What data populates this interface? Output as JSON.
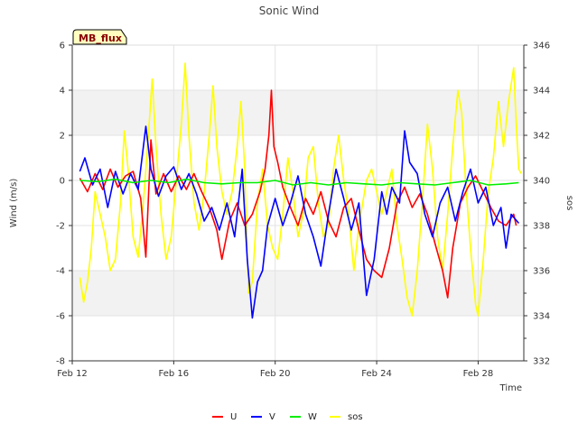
{
  "chart_data": {
    "type": "line",
    "title": "Sonic Wind",
    "badge": "MB_flux",
    "xlabel": "Time",
    "ylabel_left": "Wind (m/s)",
    "ylabel_right": "sos",
    "x_ticks": [
      "Feb 12",
      "Feb 16",
      "Feb 20",
      "Feb 24",
      "Feb 28"
    ],
    "x_tick_days": [
      12,
      16,
      20,
      24,
      28
    ],
    "xlim_days": [
      12,
      29.8
    ],
    "ylim_left": [
      -8,
      6
    ],
    "ylim_right": [
      332,
      346
    ],
    "y_ticks_left": [
      "-8",
      "-6",
      "-4",
      "-2",
      "0",
      "2",
      "4",
      "6"
    ],
    "y_ticks_right": [
      "332",
      "334",
      "336",
      "338",
      "340",
      "342",
      "344",
      "346"
    ],
    "shaded_bands_left": [
      [
        -6,
        -4
      ],
      [
        2,
        4
      ]
    ],
    "grid": true,
    "legend_position": "bottom",
    "series": [
      {
        "name": "U",
        "axis": "left",
        "color": "#ff0000",
        "points": [
          [
            12.3,
            0.1
          ],
          [
            12.6,
            -0.5
          ],
          [
            12.9,
            0.3
          ],
          [
            13.2,
            -0.4
          ],
          [
            13.5,
            0.5
          ],
          [
            13.8,
            -0.3
          ],
          [
            14.1,
            0.2
          ],
          [
            14.4,
            0.4
          ],
          [
            14.7,
            -0.8
          ],
          [
            14.9,
            -3.4
          ],
          [
            15.1,
            1.8
          ],
          [
            15.3,
            -0.6
          ],
          [
            15.6,
            0.3
          ],
          [
            15.9,
            -0.5
          ],
          [
            16.2,
            0.2
          ],
          [
            16.5,
            -0.4
          ],
          [
            16.8,
            0.3
          ],
          [
            17.1,
            -0.5
          ],
          [
            17.4,
            -1.2
          ],
          [
            17.7,
            -2.2
          ],
          [
            17.9,
            -3.5
          ],
          [
            18.2,
            -1.8
          ],
          [
            18.5,
            -1.0
          ],
          [
            18.8,
            -2.0
          ],
          [
            19.1,
            -1.5
          ],
          [
            19.4,
            -0.5
          ],
          [
            19.6,
            0.5
          ],
          [
            19.75,
            2.0
          ],
          [
            19.85,
            4.0
          ],
          [
            19.95,
            1.5
          ],
          [
            20.1,
            0.8
          ],
          [
            20.3,
            -0.3
          ],
          [
            20.6,
            -1.2
          ],
          [
            20.9,
            -2.0
          ],
          [
            21.2,
            -0.8
          ],
          [
            21.5,
            -1.5
          ],
          [
            21.8,
            -0.5
          ],
          [
            22.1,
            -1.8
          ],
          [
            22.4,
            -2.5
          ],
          [
            22.7,
            -1.2
          ],
          [
            23.0,
            -0.8
          ],
          [
            23.3,
            -2.2
          ],
          [
            23.6,
            -3.5
          ],
          [
            23.9,
            -4.0
          ],
          [
            24.2,
            -4.3
          ],
          [
            24.5,
            -3.0
          ],
          [
            24.8,
            -1.0
          ],
          [
            25.1,
            -0.3
          ],
          [
            25.4,
            -1.2
          ],
          [
            25.7,
            -0.6
          ],
          [
            26.0,
            -1.5
          ],
          [
            26.3,
            -2.8
          ],
          [
            26.6,
            -4.0
          ],
          [
            26.8,
            -5.2
          ],
          [
            27.0,
            -3.0
          ],
          [
            27.3,
            -1.0
          ],
          [
            27.6,
            -0.3
          ],
          [
            27.9,
            0.2
          ],
          [
            28.2,
            -0.5
          ],
          [
            28.5,
            -1.2
          ],
          [
            28.8,
            -1.8
          ],
          [
            29.1,
            -2.0
          ],
          [
            29.4,
            -1.5
          ],
          [
            29.5,
            -2.0
          ]
        ]
      },
      {
        "name": "V",
        "axis": "left",
        "color": "#0000ff",
        "points": [
          [
            12.3,
            0.4
          ],
          [
            12.5,
            1.0
          ],
          [
            12.8,
            -0.2
          ],
          [
            13.1,
            0.5
          ],
          [
            13.4,
            -1.2
          ],
          [
            13.7,
            0.4
          ],
          [
            14.0,
            -0.6
          ],
          [
            14.3,
            0.3
          ],
          [
            14.6,
            -0.4
          ],
          [
            14.9,
            2.4
          ],
          [
            15.1,
            0.5
          ],
          [
            15.4,
            -0.7
          ],
          [
            15.7,
            0.2
          ],
          [
            16.0,
            0.6
          ],
          [
            16.3,
            -0.4
          ],
          [
            16.6,
            0.3
          ],
          [
            16.9,
            -0.6
          ],
          [
            17.2,
            -1.8
          ],
          [
            17.5,
            -1.2
          ],
          [
            17.8,
            -2.2
          ],
          [
            18.1,
            -1.0
          ],
          [
            18.4,
            -2.5
          ],
          [
            18.7,
            0.5
          ],
          [
            18.9,
            -3.5
          ],
          [
            19.1,
            -6.1
          ],
          [
            19.3,
            -4.5
          ],
          [
            19.5,
            -4.0
          ],
          [
            19.7,
            -2.0
          ],
          [
            20.0,
            -0.8
          ],
          [
            20.3,
            -2.0
          ],
          [
            20.6,
            -1.0
          ],
          [
            20.9,
            0.2
          ],
          [
            21.2,
            -1.5
          ],
          [
            21.5,
            -2.5
          ],
          [
            21.8,
            -3.8
          ],
          [
            22.1,
            -1.5
          ],
          [
            22.4,
            0.5
          ],
          [
            22.7,
            -0.8
          ],
          [
            23.0,
            -2.2
          ],
          [
            23.3,
            -1.0
          ],
          [
            23.6,
            -5.1
          ],
          [
            23.9,
            -3.5
          ],
          [
            24.2,
            -0.5
          ],
          [
            24.4,
            -1.5
          ],
          [
            24.6,
            -0.3
          ],
          [
            24.9,
            -1.0
          ],
          [
            25.1,
            2.2
          ],
          [
            25.3,
            0.8
          ],
          [
            25.6,
            0.3
          ],
          [
            25.9,
            -1.5
          ],
          [
            26.2,
            -2.5
          ],
          [
            26.5,
            -1.0
          ],
          [
            26.8,
            -0.3
          ],
          [
            27.1,
            -1.8
          ],
          [
            27.4,
            -0.5
          ],
          [
            27.7,
            0.5
          ],
          [
            28.0,
            -1.0
          ],
          [
            28.3,
            -0.3
          ],
          [
            28.6,
            -2.0
          ],
          [
            28.9,
            -1.2
          ],
          [
            29.1,
            -3.0
          ],
          [
            29.3,
            -1.5
          ],
          [
            29.6,
            -1.9
          ]
        ]
      },
      {
        "name": "W",
        "axis": "left",
        "color": "#00ee00",
        "points": [
          [
            12.3,
            0.0
          ],
          [
            13.0,
            -0.05
          ],
          [
            13.7,
            0.05
          ],
          [
            14.4,
            -0.1
          ],
          [
            15.1,
            0.0
          ],
          [
            15.8,
            -0.1
          ],
          [
            16.5,
            0.05
          ],
          [
            17.2,
            -0.1
          ],
          [
            17.9,
            -0.15
          ],
          [
            18.6,
            -0.1
          ],
          [
            19.3,
            -0.1
          ],
          [
            20.0,
            0.0
          ],
          [
            20.7,
            -0.2
          ],
          [
            21.4,
            -0.1
          ],
          [
            22.1,
            -0.2
          ],
          [
            22.8,
            -0.1
          ],
          [
            23.5,
            -0.15
          ],
          [
            24.2,
            -0.2
          ],
          [
            24.9,
            -0.1
          ],
          [
            25.6,
            -0.15
          ],
          [
            26.3,
            -0.2
          ],
          [
            27.0,
            -0.1
          ],
          [
            27.7,
            0.0
          ],
          [
            28.4,
            -0.2
          ],
          [
            29.1,
            -0.15
          ],
          [
            29.6,
            -0.1
          ]
        ]
      },
      {
        "name": "sos",
        "axis": "right",
        "color": "#ffff00",
        "points": [
          [
            12.3,
            335.7
          ],
          [
            12.45,
            334.6
          ],
          [
            12.6,
            335.5
          ],
          [
            12.75,
            337.0
          ],
          [
            12.9,
            339.5
          ],
          [
            13.1,
            338.5
          ],
          [
            13.3,
            337.5
          ],
          [
            13.5,
            336.0
          ],
          [
            13.7,
            336.5
          ],
          [
            13.9,
            339.0
          ],
          [
            14.05,
            342.2
          ],
          [
            14.2,
            340.5
          ],
          [
            14.4,
            337.5
          ],
          [
            14.6,
            336.6
          ],
          [
            14.8,
            339.0
          ],
          [
            15.0,
            342.0
          ],
          [
            15.15,
            344.5
          ],
          [
            15.3,
            341.5
          ],
          [
            15.5,
            338.5
          ],
          [
            15.7,
            336.5
          ],
          [
            15.9,
            337.5
          ],
          [
            16.1,
            340.0
          ],
          [
            16.3,
            342.5
          ],
          [
            16.45,
            345.2
          ],
          [
            16.6,
            342.0
          ],
          [
            16.8,
            339.0
          ],
          [
            17.0,
            337.8
          ],
          [
            17.2,
            339.5
          ],
          [
            17.4,
            342.0
          ],
          [
            17.55,
            344.2
          ],
          [
            17.7,
            341.5
          ],
          [
            17.9,
            339.5
          ],
          [
            18.1,
            338.5
          ],
          [
            18.3,
            339.5
          ],
          [
            18.5,
            341.5
          ],
          [
            18.65,
            343.5
          ],
          [
            18.8,
            340.5
          ],
          [
            18.95,
            335.0
          ],
          [
            19.1,
            335.5
          ],
          [
            19.3,
            339.0
          ],
          [
            19.5,
            340.5
          ],
          [
            19.7,
            338.0
          ],
          [
            19.9,
            337.0
          ],
          [
            20.1,
            336.5
          ],
          [
            20.3,
            338.5
          ],
          [
            20.5,
            341.0
          ],
          [
            20.7,
            339.5
          ],
          [
            20.9,
            337.5
          ],
          [
            21.1,
            338.5
          ],
          [
            21.3,
            341.0
          ],
          [
            21.5,
            341.5
          ],
          [
            21.7,
            339.0
          ],
          [
            21.9,
            337.5
          ],
          [
            22.1,
            338.0
          ],
          [
            22.3,
            340.5
          ],
          [
            22.5,
            342.0
          ],
          [
            22.7,
            340.0
          ],
          [
            22.9,
            338.5
          ],
          [
            23.1,
            336.0
          ],
          [
            23.3,
            338.0
          ],
          [
            23.6,
            340.0
          ],
          [
            23.8,
            340.5
          ],
          [
            24.0,
            339.5
          ],
          [
            24.2,
            338.5
          ],
          [
            24.4,
            339.5
          ],
          [
            24.6,
            340.5
          ],
          [
            24.8,
            338.0
          ],
          [
            25.0,
            336.5
          ],
          [
            25.2,
            334.8
          ],
          [
            25.4,
            334.0
          ],
          [
            25.6,
            336.0
          ],
          [
            25.8,
            339.0
          ],
          [
            26.0,
            342.5
          ],
          [
            26.2,
            340.5
          ],
          [
            26.4,
            337.5
          ],
          [
            26.6,
            336.0
          ],
          [
            26.8,
            338.5
          ],
          [
            27.0,
            341.5
          ],
          [
            27.2,
            344.0
          ],
          [
            27.35,
            343.0
          ],
          [
            27.5,
            340.0
          ],
          [
            27.7,
            337.0
          ],
          [
            27.9,
            334.5
          ],
          [
            28.0,
            334.0
          ],
          [
            28.2,
            336.5
          ],
          [
            28.4,
            339.5
          ],
          [
            28.6,
            341.0
          ],
          [
            28.8,
            343.5
          ],
          [
            29.0,
            341.5
          ],
          [
            29.2,
            343.5
          ],
          [
            29.4,
            345.0
          ],
          [
            29.5,
            342.5
          ],
          [
            29.6,
            340.5
          ],
          [
            29.7,
            340.3
          ]
        ]
      }
    ]
  }
}
